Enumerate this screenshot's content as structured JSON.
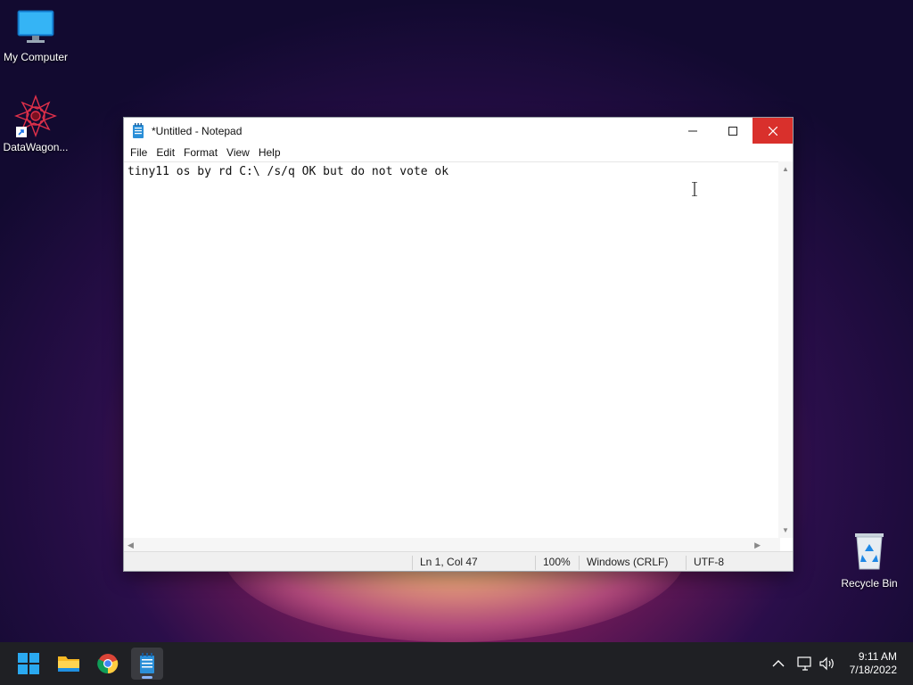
{
  "desktop": {
    "icons": [
      {
        "label": "My Computer",
        "icon": "monitor-icon"
      },
      {
        "label": "DataWagon...",
        "icon": "datawagon-app-icon"
      },
      {
        "label": "Recycle Bin",
        "icon": "recycle-bin-icon"
      }
    ]
  },
  "notepad": {
    "title": "*Untitled - Notepad",
    "menu": [
      "File",
      "Edit",
      "Format",
      "View",
      "Help"
    ],
    "content": "tiny11 os by rd C:\\ /s/q OK but do not vote ok",
    "status": {
      "position": "Ln 1, Col 47",
      "zoom": "100%",
      "line_ending": "Windows (CRLF)",
      "encoding": "UTF-8"
    }
  },
  "taskbar": {
    "apps": [
      "start-icon",
      "file-explorer-icon",
      "chrome-icon",
      "notepad-icon"
    ],
    "active_app": "notepad-icon",
    "tray_icons": [
      "chevron-up-icon",
      "network-icon",
      "volume-icon"
    ],
    "clock": {
      "time": "9:11 AM",
      "date": "7/18/2022"
    }
  },
  "colors": {
    "close_button": "#d9302c",
    "taskbar": "#1f2024"
  }
}
